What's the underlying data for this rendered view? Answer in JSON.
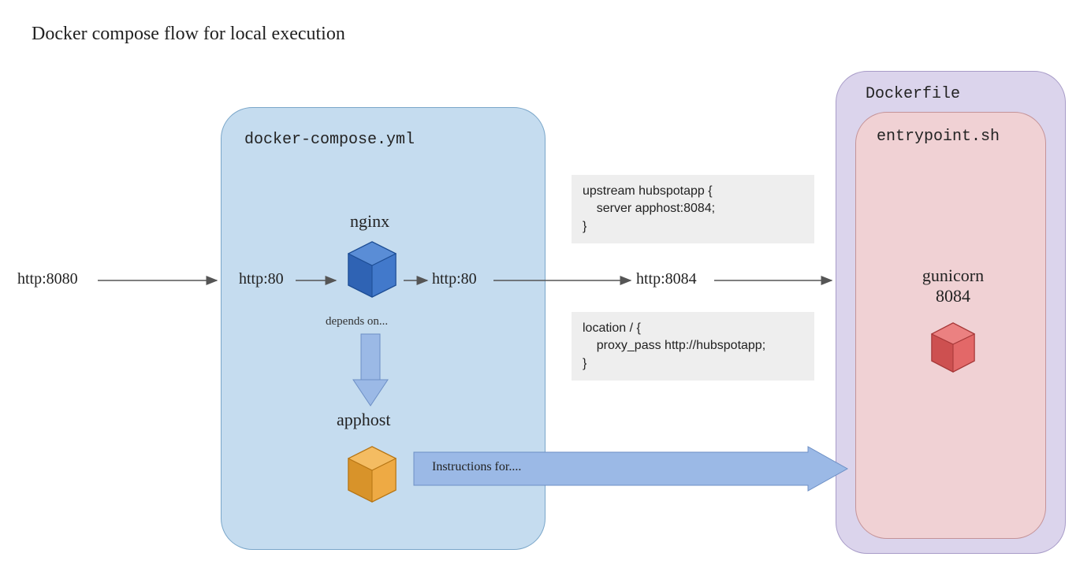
{
  "title": "Docker compose flow for local execution",
  "compose": {
    "label": "docker-compose.yml",
    "nginx": "nginx",
    "depends_on": "depends on...",
    "apphost": "apphost"
  },
  "dockerfile": {
    "label": "Dockerfile",
    "entrypoint": "entrypoint.sh",
    "gunicorn": "gunicorn\n8084"
  },
  "labels": {
    "http8080_in": "http:8080",
    "http80_in": "http:80",
    "http80_out": "http:80",
    "http8084": "http:8084",
    "instructions": "Instructions for...."
  },
  "code": {
    "upstream": "upstream hubspotapp {\n    server apphost:8084;\n}",
    "location": "location / {\n    proxy_pass http://hubspotapp;\n}"
  }
}
